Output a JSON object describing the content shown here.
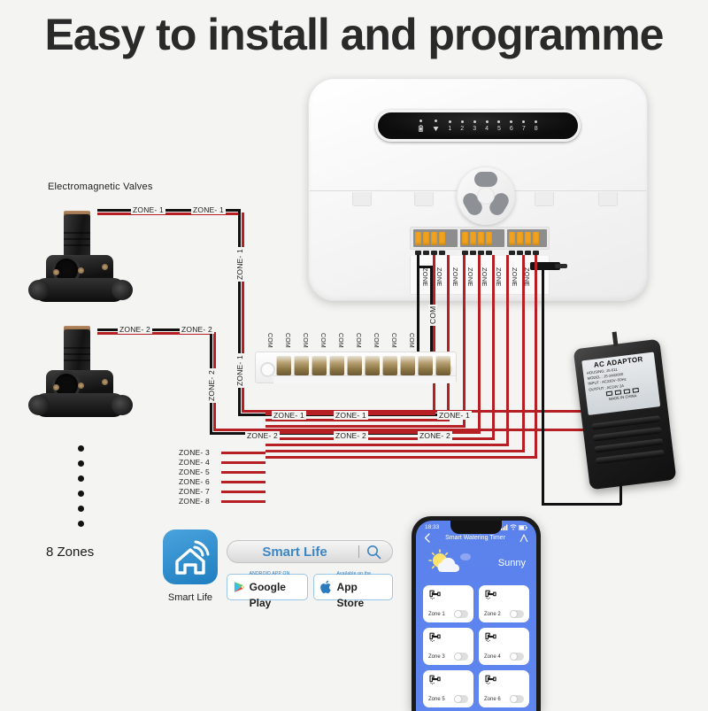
{
  "title": "Easy to install and  programme",
  "controller": {
    "led_panel": {
      "indicators": [
        {
          "icon": "battery-icon",
          "label": ""
        },
        {
          "icon": "wifi-icon",
          "label": ""
        },
        {
          "icon": "",
          "label": "1"
        },
        {
          "icon": "",
          "label": "2"
        },
        {
          "icon": "",
          "label": "3"
        },
        {
          "icon": "",
          "label": "4"
        },
        {
          "icon": "",
          "label": "5"
        },
        {
          "icon": "",
          "label": "6"
        },
        {
          "icon": "",
          "label": "7"
        },
        {
          "icon": "",
          "label": "8"
        }
      ]
    },
    "terminal_wire_labels": [
      "ZONE",
      "ZONE",
      "ZONE",
      "ZONE",
      "ZONE",
      "ZONE",
      "ZONE",
      "ZONE"
    ],
    "com_wire_label": "COM"
  },
  "valves": {
    "heading": "Electromagnetic Valves",
    "zones_caption": "8 Zones",
    "dot_count": 6
  },
  "wire_labels": {
    "zone1": "ZONE- 1",
    "zone2": "ZONE- 2",
    "com": "COM",
    "zone_list": [
      "ZONE- 3",
      "ZONE- 4",
      "ZONE- 5",
      "ZONE- 6",
      "ZONE- 7",
      "ZONE- 8"
    ]
  },
  "terminal_block": {
    "com_labels": [
      "COM",
      "COM",
      "COM",
      "COM",
      "COM",
      "COM",
      "COM",
      "COM",
      "COM"
    ],
    "pin_count": 10
  },
  "adaptor": {
    "title": "AC ADAPTOR",
    "lines": [
      "HOUSING:  JS-611",
      "MODEL  :  JS-2402000",
      "INPUT   :  AC220V~50Hz",
      "OUTPUT :  AC24V  2A"
    ],
    "made_in": "MADE IN CHINA"
  },
  "smart_life": {
    "app_name": "Smart Life",
    "caption": "Smart Life",
    "search_value": "Smart Life",
    "google_play": {
      "sub": "ANDROID APP ON",
      "main": "Google Play"
    },
    "app_store": {
      "sub": "Available on the",
      "main": "App Store"
    }
  },
  "phone": {
    "status_time": "18:33",
    "nav_title": "Smart Watering Timer",
    "weather": "Sunny",
    "zones": [
      {
        "name": "Zone 1",
        "on": false
      },
      {
        "name": "Zone 2",
        "on": false
      },
      {
        "name": "Zone 3",
        "on": false
      },
      {
        "name": "Zone 4",
        "on": false
      },
      {
        "name": "Zone 5",
        "on": false
      },
      {
        "name": "Zone 6",
        "on": false
      }
    ]
  },
  "colors": {
    "wire_red": "#b61f24",
    "wire_black": "#111111",
    "terminal_orange": "#f0a21f",
    "app_blue": "#5b82ec",
    "brand_blue": "#1e7ec0"
  }
}
